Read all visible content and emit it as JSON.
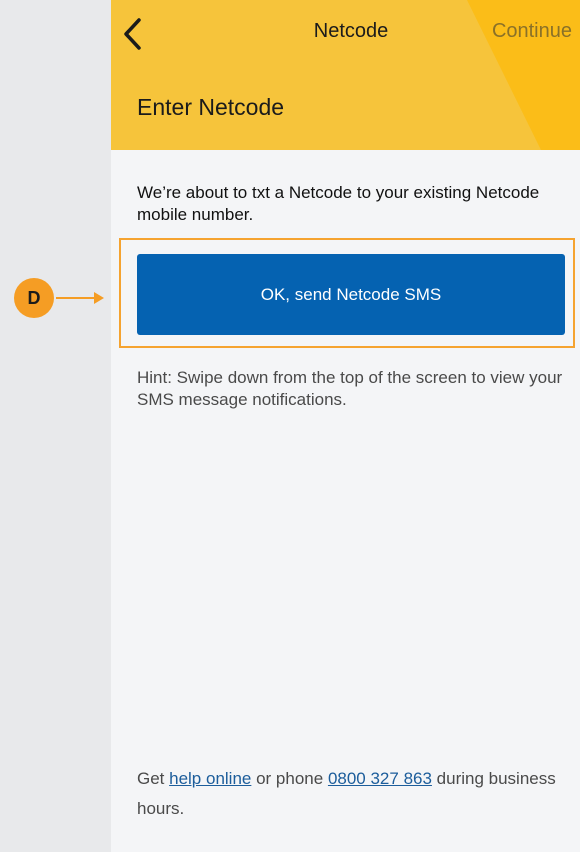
{
  "header": {
    "title": "Netcode",
    "continue_label": "Continue",
    "back_icon": "chevron-left-icon",
    "page_heading": "Enter Netcode"
  },
  "content": {
    "intro_text": "We’re about to txt a Netcode to your existing Netcode mobile number.",
    "send_button_label": "OK, send Netcode SMS",
    "hint_text": "Hint: Swipe down from the top of the screen to view your SMS message notifications."
  },
  "footer": {
    "prefix": "Get ",
    "help_link": "help online",
    "middle": " or phone ",
    "phone_link": "0800 327 863",
    "suffix": " during business hours."
  },
  "annotation": {
    "marker_label": "D",
    "marker_color": "#f59d24"
  },
  "colors": {
    "header_yellow": "#f6c43b",
    "button_blue": "#0562b1",
    "link_blue": "#1c5d9b"
  }
}
